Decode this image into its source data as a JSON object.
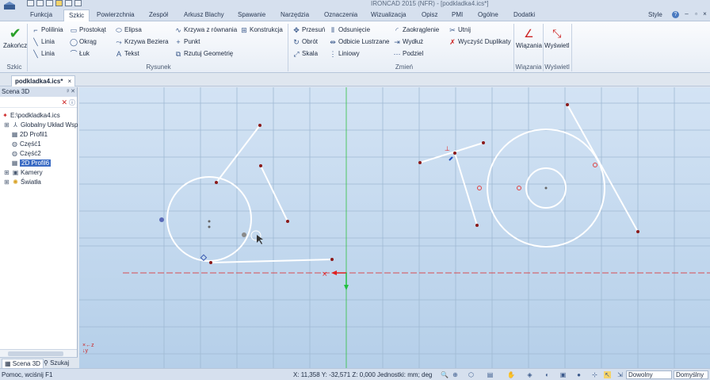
{
  "window": {
    "title": "IRONCAD 2015 (NFR) - [podkladka4.ics*]"
  },
  "ribbon_tabs": [
    {
      "label": "Funkcja"
    },
    {
      "label": "Szkic",
      "active": true
    },
    {
      "label": "Powierzchnia"
    },
    {
      "label": "Zespół"
    },
    {
      "label": "Arkusz Blachy"
    },
    {
      "label": "Spawanie"
    },
    {
      "label": "Narzędzia"
    },
    {
      "label": "Oznaczenia"
    },
    {
      "label": "Wizualizacja"
    },
    {
      "label": "Opisz"
    },
    {
      "label": "PMI"
    },
    {
      "label": "Ogólne"
    },
    {
      "label": "Dodatki"
    }
  ],
  "style_label": "Style",
  "ribbon": {
    "finish_label": "Zakończ",
    "group_szkic": "Szkic",
    "group_rysunek": "Rysunek",
    "group_zmien": "Zmień",
    "group_wiazania": "Wiązania",
    "group_wyswietl": "Wyświetl",
    "rysunek_items": [
      [
        "Polilinia",
        "Prostokąt",
        "Elipsa",
        "Krzywa z równania",
        "Konstrukcja"
      ],
      [
        "Linia",
        "Okrąg",
        "Krzywa Beziera",
        "Punkt"
      ],
      [
        "Linia",
        "Łuk",
        "Tekst",
        "Rzutuj Geometrię"
      ]
    ],
    "zmien_items": [
      [
        "Przesuń",
        "Odsunięcie",
        "Zaokrąglenie",
        "Utnij"
      ],
      [
        "Obrót",
        "Odbicie Lustrzane",
        "Wydłuż",
        "Wyczyść Duplikaty"
      ],
      [
        "Skala",
        "Liniowy",
        "Podziel"
      ]
    ],
    "wiazania_label": "Wiązania",
    "wyswietl_label": "Wyświetl"
  },
  "doc_tab": {
    "label": "podkladka4.ics*",
    "close": "×"
  },
  "scene_panel": {
    "title": "Scena 3D",
    "pin": "ᵖ ✕",
    "tree": [
      {
        "label": "E:\\podkladka4.ics",
        "icon": "scene-icon"
      },
      {
        "label": "Globalny Układ Wsp",
        "icon": "axes-icon"
      },
      {
        "label": "2D Profil1",
        "icon": "profile-icon"
      },
      {
        "label": "Część1",
        "icon": "part-icon"
      },
      {
        "label": "Część2",
        "icon": "part-icon"
      },
      {
        "label": "2D Profil6",
        "icon": "profile-icon",
        "selected": true
      },
      {
        "label": "Kamery",
        "icon": "camera-icon"
      },
      {
        "label": "Światła",
        "icon": "light-icon"
      }
    ]
  },
  "bottom_tabs": [
    {
      "label": "Scena 3D",
      "active": true
    },
    {
      "label": "Szukaj"
    }
  ],
  "status": {
    "help": "Pomoc, wciśnij F1",
    "coords": "X: 11,358 Y: -32,571 Z: 0,000",
    "units": "Jednostki: mm; deg",
    "select1": "Dowolny",
    "select2": "Domyślny"
  },
  "colors": {
    "accent": "#3a6bc4",
    "sketch_line": "#ffffff",
    "sketch_point": "#8b1a1a",
    "axis_red": "#e02020",
    "axis_green": "#20c040"
  }
}
